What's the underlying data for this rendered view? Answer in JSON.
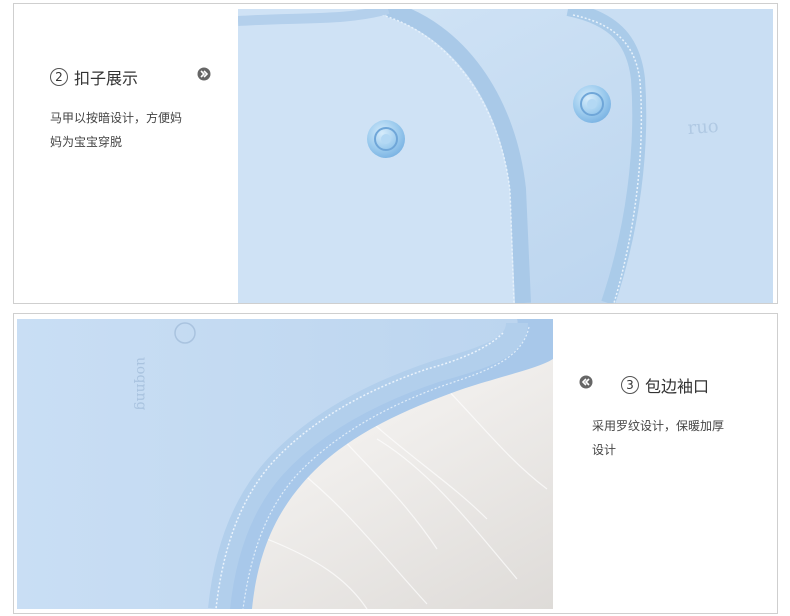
{
  "features": [
    {
      "number": "2",
      "title": "扣子展示",
      "desc_line1": "马甲以按暗设计，方便妈",
      "desc_line2": "妈为宝宝穿脱",
      "arrow_icon": "double-chevron-right-icon"
    },
    {
      "number": "3",
      "title": "包边袖口",
      "desc_line1": "采用罗纹设计，保暖加厚",
      "desc_line2": "设计",
      "arrow_icon": "double-chevron-left-icon"
    }
  ],
  "colors": {
    "fabric_blue": "#c7ddf2",
    "button_blue": "#9ccbee",
    "border_gray": "#cfcfcf",
    "fur_white": "#ece9e6"
  }
}
